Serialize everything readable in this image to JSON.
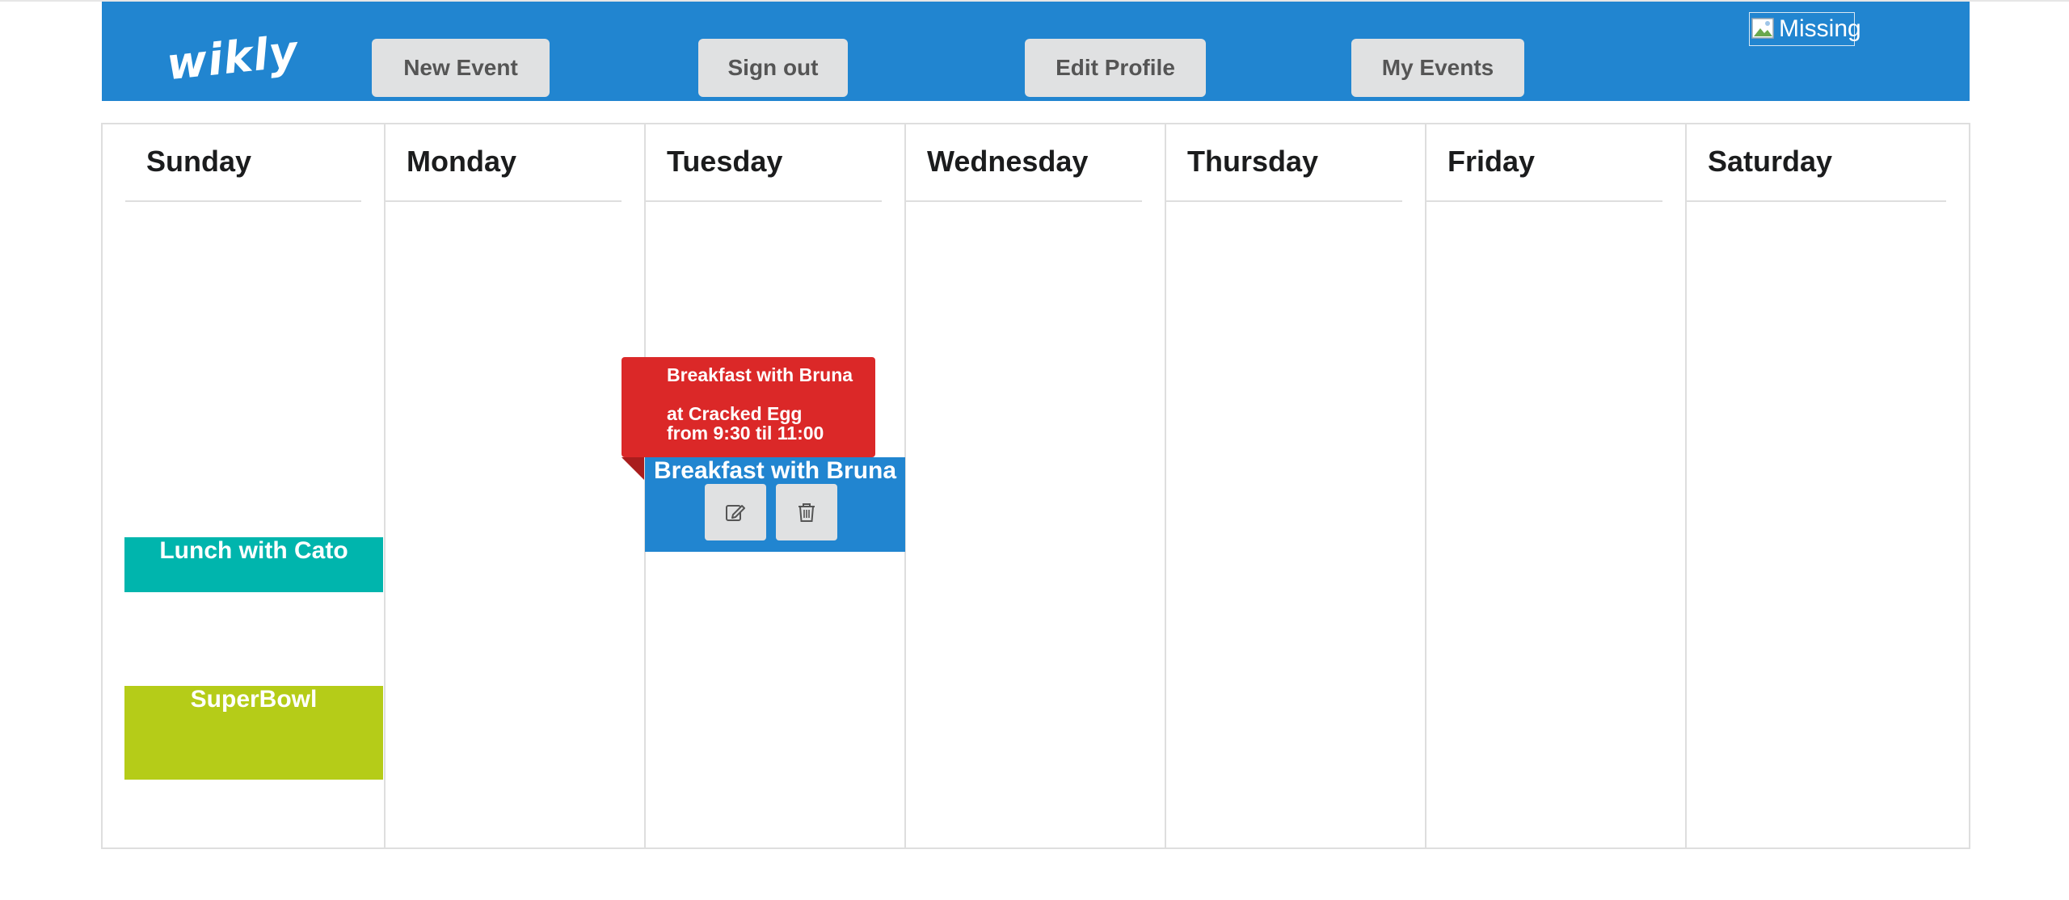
{
  "header": {
    "logo": "wikly",
    "buttons": {
      "new_event": "New Event",
      "sign_out": "Sign out",
      "edit_profile": "Edit Profile",
      "my_events": "My Events"
    },
    "avatar_alt": "Missing"
  },
  "days": [
    "Sunday",
    "Monday",
    "Tuesday",
    "Wednesday",
    "Thursday",
    "Friday",
    "Saturday"
  ],
  "events": {
    "lunch": {
      "title": "Lunch with Cato",
      "color": "#00b5ad"
    },
    "superbowl": {
      "title": "SuperBowl",
      "color": "#b5cc18"
    },
    "breakfast": {
      "title": "Breakfast with Bruna",
      "color": "#2185d0"
    }
  },
  "tooltip": {
    "title": "Breakfast with Bruna",
    "location": "at Cracked Egg",
    "time": "from 9:30 til 11:00",
    "color": "#db2828"
  },
  "icons": {
    "edit": "edit-icon",
    "delete": "trash-icon"
  }
}
